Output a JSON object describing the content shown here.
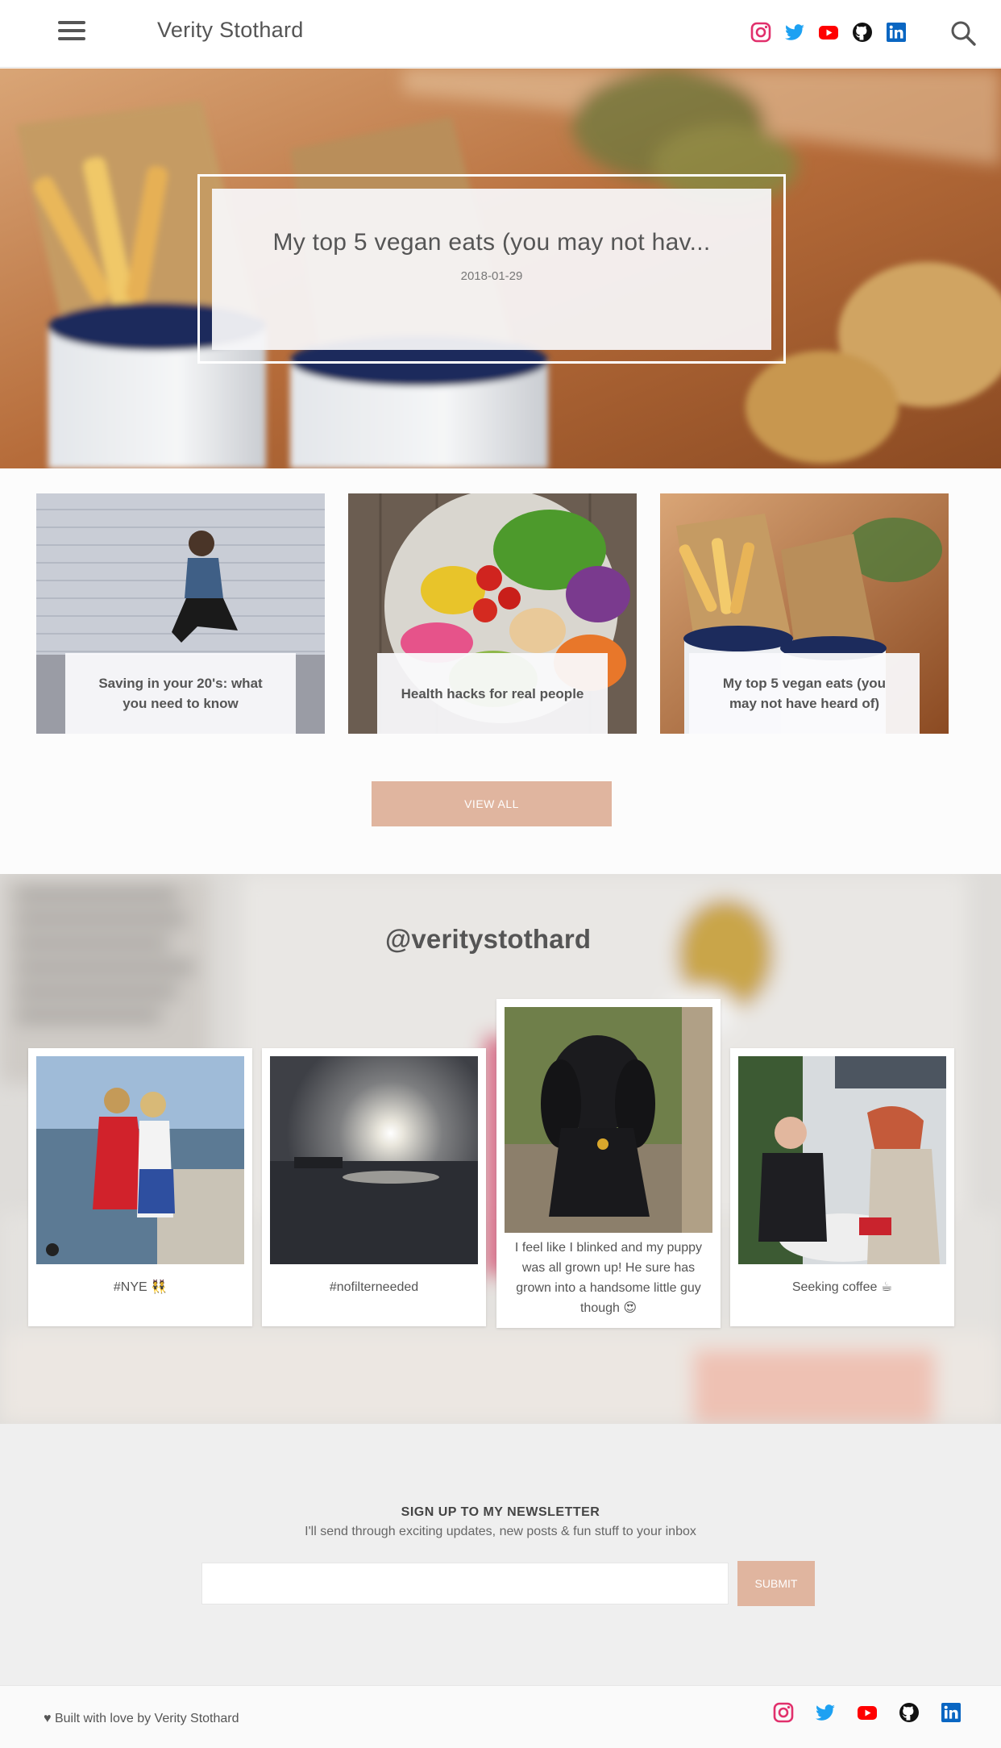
{
  "header": {
    "site_title": "Verity Stothard",
    "menu_icon": "hamburger-menu-icon",
    "search_icon": "search-icon",
    "social": [
      "instagram-icon",
      "twitter-icon",
      "youtube-icon",
      "github-icon",
      "linkedin-icon"
    ]
  },
  "hero": {
    "title": "My top 5 vegan eats (you may not hav...",
    "date": "2018-01-29"
  },
  "posts": [
    {
      "title": "Saving in your 20's: what you need to know"
    },
    {
      "title": "Health hacks for real people"
    },
    {
      "title": "My top 5 vegan eats (you may not have heard of)"
    }
  ],
  "view_all_label": "VIEW ALL",
  "instagram": {
    "handle": "@veritystothard",
    "items": [
      {
        "caption": "#NYE 👯"
      },
      {
        "caption": "#nofilterneeded"
      },
      {
        "caption": "I feel like I blinked and my puppy was all grown up! He sure has grown into a handsome little guy though 😍"
      },
      {
        "caption": "Seeking coffee ☕"
      }
    ]
  },
  "newsletter": {
    "heading": "SIGN UP TO MY NEWSLETTER",
    "subheading": "I'll send through exciting updates, new posts & fun stuff to your inbox",
    "input_value": "",
    "submit_label": "SUBMIT"
  },
  "footer": {
    "text": "♥ Built with love by Verity Stothard"
  },
  "colors": {
    "accent": "#e0b59f",
    "instagram": "#e1306c",
    "twitter": "#1da1f2",
    "youtube": "#ff0000",
    "github": "#111111",
    "linkedin": "#0a66c2"
  }
}
